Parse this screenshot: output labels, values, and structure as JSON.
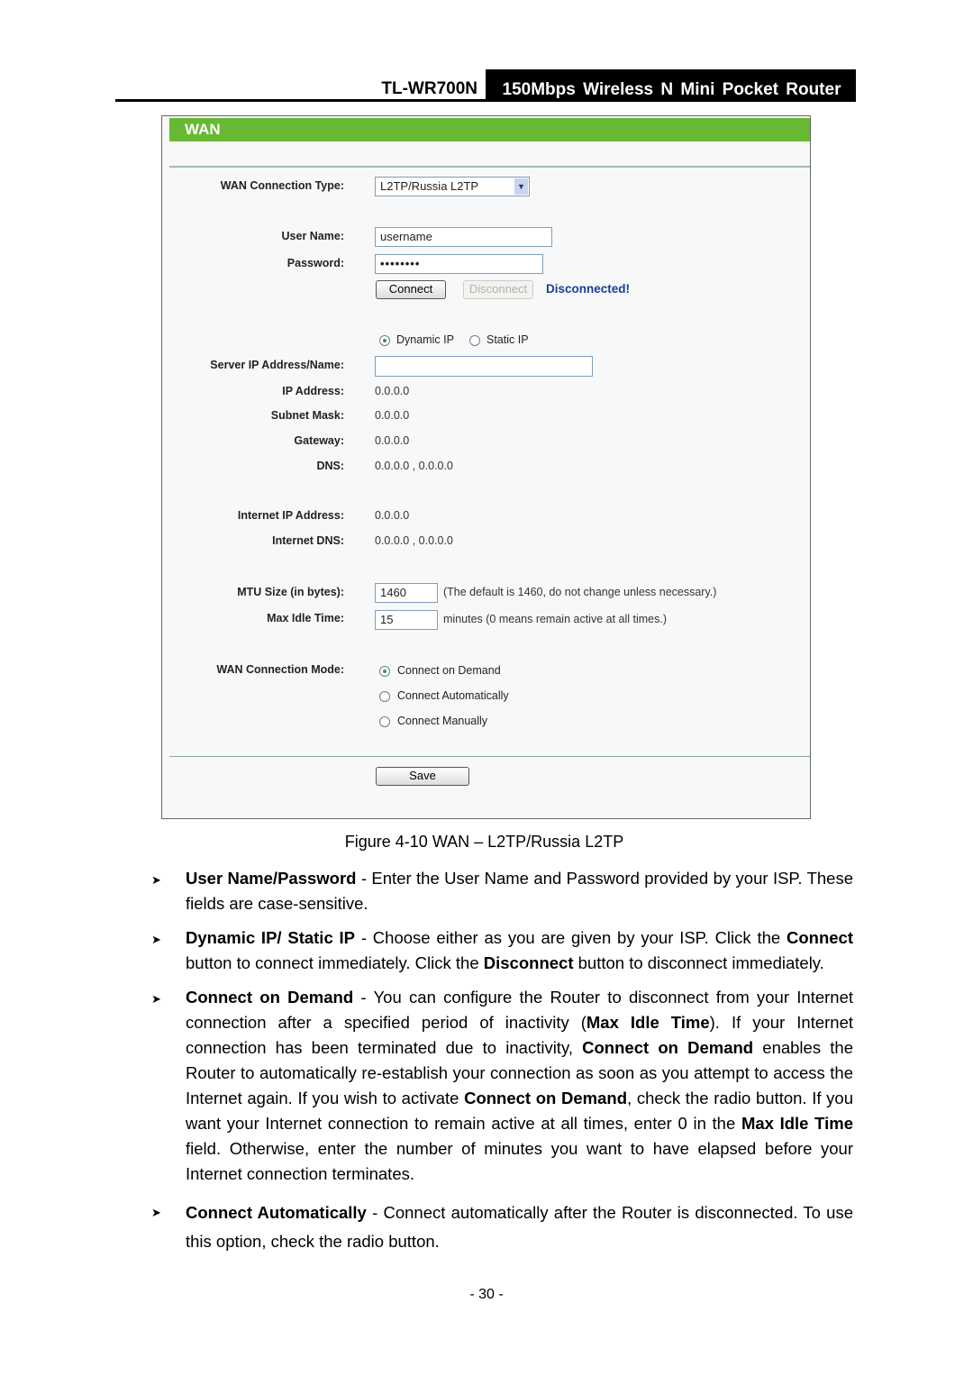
{
  "header": {
    "model": "TL-WR700N",
    "title": "150Mbps Wireless N Mini Pocket Router"
  },
  "wan": {
    "title": "WAN",
    "connection_type_label": "WAN Connection Type:",
    "connection_type_value": "L2TP/Russia L2TP",
    "username_label": "User Name:",
    "username_value": "username",
    "password_label": "Password:",
    "password_value": "••••••••",
    "connect_label": "Connect",
    "disconnect_label": "Disconnect",
    "status": "Disconnected!",
    "dynamic_ip": "Dynamic IP",
    "static_ip": "Static IP",
    "ip_mode_selected": "Dynamic IP",
    "server_label": "Server IP Address/Name:",
    "server_value": "",
    "ip_label": "IP Address:",
    "ip_value": "0.0.0.0",
    "mask_label": "Subnet Mask:",
    "mask_value": "0.0.0.0",
    "gateway_label": "Gateway:",
    "gateway_value": "0.0.0.0",
    "dns_label": "DNS:",
    "dns_value": "0.0.0.0 , 0.0.0.0",
    "inet_ip_label": "Internet IP Address:",
    "inet_ip_value": "0.0.0.0",
    "inet_dns_label": "Internet DNS:",
    "inet_dns_value": "0.0.0.0 , 0.0.0.0",
    "mtu_label": "MTU Size (in bytes):",
    "mtu_value": "1460",
    "mtu_hint": "(The default is 1460, do not change unless necessary.)",
    "idle_label": "Max Idle Time:",
    "idle_value": "15",
    "idle_hint": "minutes (0 means remain active at all times.)",
    "mode_label": "WAN Connection Mode:",
    "modes": [
      "Connect on Demand",
      "Connect Automatically",
      "Connect Manually"
    ],
    "mode_selected": "Connect on Demand",
    "save_label": "Save"
  },
  "caption": "Figure 4-10 WAN – L2TP/Russia L2TP",
  "bullets": [
    {
      "bold": "User Name/Password",
      "text": " - Enter the User Name and Password provided by your ISP. These fields are case-sensitive."
    },
    {
      "bold": "Dynamic IP/ Static IP",
      "text1": " - Choose either as you are given by your ISP. Click the ",
      "b2": "Connect",
      "text2": " button to connect immediately. Click the ",
      "b3": "Disconnect",
      "text3": " button to disconnect immediately."
    },
    {
      "bold": "Connect on Demand",
      "text1": " - You can configure the Router to disconnect from your Internet connection after a specified period of inactivity (",
      "b2": "Max Idle Time",
      "text2": "). If your Internet connection has been terminated due to inactivity, ",
      "b3": "Connect on Demand",
      "text3": " enables the Router to automatically re-establish your connection as soon as you attempt to access the Internet again. If you wish to activate ",
      "b4": "Connect on Demand",
      "text4": ", check the radio button. If you want your Internet connection to remain active at all times, enter 0 in the ",
      "b5": "Max Idle Time",
      "text5": " field. Otherwise, enter the number of minutes you want to have elapsed before your Internet connection terminates."
    },
    {
      "bold": "Connect Automatically",
      "text": " - Connect automatically after the Router is disconnected. To use this option, check the radio button."
    }
  ],
  "page_number": "- 30 -"
}
